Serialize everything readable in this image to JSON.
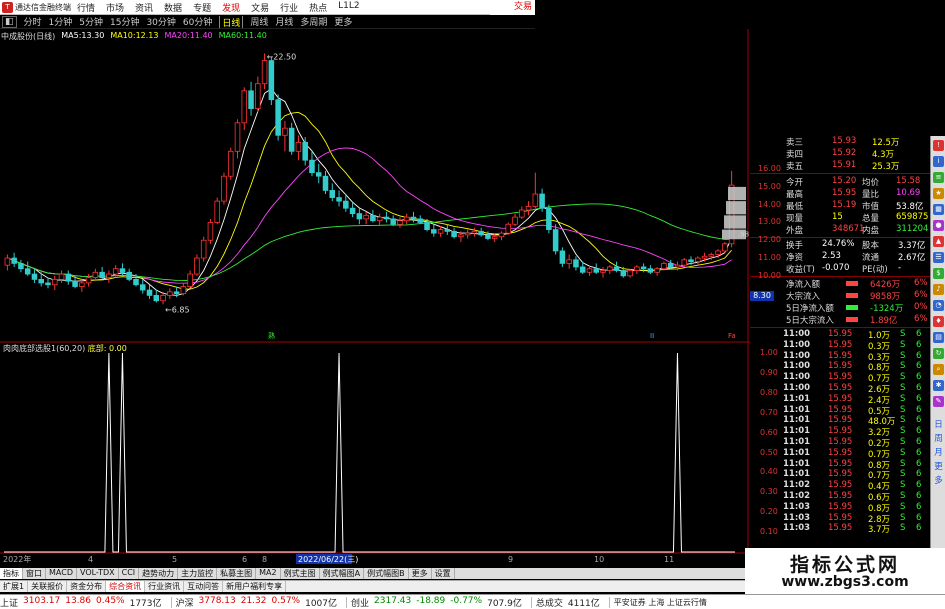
{
  "app": {
    "title": "通达信金融终端",
    "top_right": "交易"
  },
  "menu": [
    "行情",
    "市场",
    "资讯",
    "数据",
    "专题",
    "发现",
    "文易",
    "行业",
    "热点",
    "L1L2"
  ],
  "periods": [
    {
      "label": "分时",
      "active": false
    },
    {
      "label": "1分钟",
      "active": false
    },
    {
      "label": "5分钟",
      "active": false
    },
    {
      "label": "15分钟",
      "active": false
    },
    {
      "label": "30分钟",
      "active": false
    },
    {
      "label": "60分钟",
      "active": false
    },
    {
      "label": "日线",
      "active": true
    },
    {
      "label": "周线",
      "active": false
    },
    {
      "label": "月线",
      "active": false
    },
    {
      "label": "多周期",
      "active": false
    },
    {
      "label": "更多",
      "active": false
    }
  ],
  "legend": {
    "stock": "中成股份(日线)",
    "ma": [
      {
        "name": "MA5:",
        "value": "13.30",
        "color": "#ffffff"
      },
      {
        "name": "MA10:",
        "value": "12.13",
        "color": "#ffff00"
      },
      {
        "name": "MA20:",
        "value": "11.40",
        "color": "#ff44ff"
      },
      {
        "name": "MA60:",
        "value": "11.40",
        "color": "#33ee33"
      }
    ]
  },
  "price_annotations": {
    "high": "22.50",
    "low": "6.85",
    "right": ".98"
  },
  "event_marks": [
    {
      "label": "熟",
      "color": "#33ee33"
    },
    {
      "label": "II",
      "color": "#44aaff"
    },
    {
      "label": "Fa",
      "color": "#ff4444"
    }
  ],
  "indicator": {
    "title": "肉肉底部选股1(60,20)",
    "sub": "底部: 0.00"
  },
  "price_ticks": [
    "16.00",
    "15.00",
    "14.00",
    "13.00",
    "12.00",
    "11.00",
    "10.00"
  ],
  "price_tag": "8.30",
  "ind_ticks": [
    "1.00",
    "0.90",
    "0.80",
    "0.70",
    "0.60",
    "0.50",
    "0.40",
    "0.30",
    "0.20",
    "0.10"
  ],
  "xaxis": {
    "labels": [
      "2022年",
      "4",
      "5",
      "6",
      "8",
      "2022/06/22(三)",
      "9",
      "10",
      "11"
    ]
  },
  "chart_data": {
    "type": "candlestick",
    "candles_ohlc": [
      [
        10.6,
        11.2,
        10.3,
        11.0
      ],
      [
        11.0,
        11.3,
        10.5,
        10.7
      ],
      [
        10.7,
        10.9,
        10.2,
        10.4
      ],
      [
        10.4,
        10.8,
        10.0,
        10.1
      ],
      [
        10.1,
        10.4,
        9.6,
        9.8
      ],
      [
        9.8,
        10.2,
        9.4,
        9.6
      ],
      [
        9.6,
        9.9,
        9.3,
        9.5
      ],
      [
        9.5,
        10.0,
        9.2,
        9.8
      ],
      [
        9.8,
        10.3,
        9.6,
        10.1
      ],
      [
        10.1,
        10.3,
        9.5,
        9.7
      ],
      [
        9.7,
        10.0,
        9.3,
        9.4
      ],
      [
        9.4,
        9.8,
        9.1,
        9.6
      ],
      [
        9.6,
        10.1,
        9.4,
        9.9
      ],
      [
        9.9,
        10.4,
        9.7,
        10.2
      ],
      [
        10.2,
        10.5,
        9.8,
        9.9
      ],
      [
        9.9,
        10.3,
        9.6,
        10.1
      ],
      [
        10.1,
        10.6,
        9.9,
        10.4
      ],
      [
        10.4,
        10.7,
        10.0,
        10.2
      ],
      [
        10.2,
        10.4,
        9.7,
        9.8
      ],
      [
        9.8,
        10.1,
        9.4,
        9.5
      ],
      [
        9.5,
        9.8,
        9.0,
        9.2
      ],
      [
        9.2,
        9.5,
        8.7,
        8.9
      ],
      [
        8.9,
        9.2,
        8.5,
        8.6
      ],
      [
        8.6,
        9.1,
        8.4,
        8.9
      ],
      [
        8.9,
        9.3,
        8.7,
        9.1
      ],
      [
        9.1,
        9.4,
        8.8,
        9.0
      ],
      [
        9.0,
        9.6,
        8.9,
        9.4
      ],
      [
        9.4,
        10.3,
        9.3,
        10.1
      ],
      [
        10.1,
        11.2,
        10.0,
        11.0
      ],
      [
        11.0,
        12.2,
        10.8,
        12.0
      ],
      [
        12.0,
        13.2,
        11.8,
        13.0
      ],
      [
        13.0,
        14.4,
        12.9,
        14.2
      ],
      [
        14.2,
        15.8,
        14.0,
        15.6
      ],
      [
        15.6,
        17.2,
        15.4,
        17.0
      ],
      [
        17.0,
        18.8,
        16.6,
        18.6
      ],
      [
        18.6,
        20.6,
        18.2,
        20.4
      ],
      [
        20.4,
        20.9,
        19.0,
        19.4
      ],
      [
        19.4,
        21.2,
        19.2,
        20.8
      ],
      [
        20.8,
        22.5,
        20.5,
        22.1
      ],
      [
        22.1,
        22.3,
        19.6,
        19.9
      ],
      [
        19.9,
        20.2,
        17.6,
        17.9
      ],
      [
        17.9,
        18.7,
        17.0,
        18.3
      ],
      [
        18.3,
        18.6,
        16.8,
        17.0
      ],
      [
        17.0,
        17.9,
        16.5,
        17.5
      ],
      [
        17.5,
        17.8,
        16.2,
        16.5
      ],
      [
        16.5,
        17.0,
        15.6,
        15.8
      ],
      [
        15.8,
        16.3,
        15.2,
        15.6
      ],
      [
        15.6,
        15.9,
        14.6,
        14.8
      ],
      [
        14.8,
        15.2,
        14.2,
        14.4
      ],
      [
        14.4,
        14.8,
        13.9,
        14.2
      ],
      [
        14.2,
        14.6,
        13.6,
        13.8
      ],
      [
        13.8,
        14.1,
        13.3,
        13.5
      ],
      [
        13.5,
        13.8,
        12.9,
        13.2
      ],
      [
        13.2,
        13.6,
        12.9,
        13.4
      ],
      [
        13.4,
        13.7,
        13.0,
        13.1
      ],
      [
        13.1,
        13.5,
        12.8,
        13.3
      ],
      [
        13.3,
        13.6,
        13.0,
        13.2
      ],
      [
        13.2,
        13.4,
        12.8,
        12.9
      ],
      [
        12.9,
        13.3,
        12.7,
        13.1
      ],
      [
        13.1,
        13.5,
        12.9,
        13.3
      ],
      [
        13.3,
        13.6,
        13.0,
        13.2
      ],
      [
        13.2,
        13.4,
        12.9,
        13.0
      ],
      [
        13.0,
        13.2,
        12.5,
        12.6
      ],
      [
        12.6,
        12.9,
        12.2,
        12.4
      ],
      [
        12.4,
        12.8,
        12.2,
        12.6
      ],
      [
        12.6,
        12.9,
        12.3,
        12.5
      ],
      [
        12.5,
        12.7,
        12.1,
        12.2
      ],
      [
        12.2,
        12.5,
        11.9,
        12.3
      ],
      [
        12.3,
        12.6,
        12.1,
        12.4
      ],
      [
        12.4,
        12.7,
        12.2,
        12.5
      ],
      [
        12.5,
        12.7,
        12.2,
        12.3
      ],
      [
        12.3,
        12.5,
        12.0,
        12.1
      ],
      [
        12.1,
        12.4,
        11.9,
        12.2
      ],
      [
        12.2,
        12.5,
        12.0,
        12.4
      ],
      [
        12.4,
        13.0,
        12.3,
        12.9
      ],
      [
        12.9,
        13.5,
        12.8,
        13.3
      ],
      [
        13.3,
        13.9,
        13.2,
        13.7
      ],
      [
        13.7,
        14.2,
        13.4,
        13.9
      ],
      [
        13.9,
        15.8,
        13.8,
        14.6
      ],
      [
        14.6,
        14.9,
        13.6,
        13.8
      ],
      [
        13.8,
        14.0,
        12.4,
        12.6
      ],
      [
        12.6,
        12.9,
        11.2,
        11.4
      ],
      [
        11.4,
        11.6,
        10.5,
        10.7
      ],
      [
        10.7,
        11.2,
        10.4,
        10.9
      ],
      [
        10.9,
        11.1,
        10.3,
        10.5
      ],
      [
        10.5,
        10.8,
        10.1,
        10.2
      ],
      [
        10.2,
        10.6,
        10.0,
        10.4
      ],
      [
        10.4,
        10.7,
        10.1,
        10.2
      ],
      [
        10.2,
        10.5,
        9.9,
        10.3
      ],
      [
        10.3,
        10.6,
        10.1,
        10.5
      ],
      [
        10.5,
        10.8,
        10.2,
        10.3
      ],
      [
        10.3,
        10.5,
        9.9,
        10.0
      ],
      [
        10.0,
        10.4,
        9.9,
        10.3
      ],
      [
        10.3,
        10.6,
        10.1,
        10.5
      ],
      [
        10.5,
        10.7,
        10.2,
        10.4
      ],
      [
        10.4,
        10.6,
        10.1,
        10.2
      ],
      [
        10.2,
        10.5,
        10.0,
        10.4
      ],
      [
        10.4,
        10.8,
        10.3,
        10.7
      ],
      [
        10.7,
        10.9,
        10.4,
        10.5
      ],
      [
        10.5,
        10.8,
        10.3,
        10.6
      ],
      [
        10.6,
        11.0,
        10.5,
        10.9
      ],
      [
        10.9,
        11.1,
        10.6,
        10.8
      ],
      [
        10.8,
        11.1,
        10.6,
        11.0
      ],
      [
        11.0,
        11.3,
        10.8,
        11.1
      ],
      [
        11.1,
        11.3,
        10.9,
        11.2
      ],
      [
        11.2,
        11.5,
        11.0,
        11.4
      ],
      [
        11.4,
        11.9,
        11.3,
        11.8
      ],
      [
        11.8,
        15.9,
        11.6,
        15.1
      ]
    ],
    "ylim": [
      6.0,
      23.2
    ],
    "indicator_spikes": [
      15,
      17,
      49,
      99
    ],
    "indicator_ylim": [
      0,
      1.0
    ]
  },
  "quote": {
    "rows": [
      {
        "l": "卖三",
        "v": "15.93",
        "r": "12.5万"
      },
      {
        "l": "卖四",
        "v": "15.92",
        "r": "4.3万"
      },
      {
        "l": "卖五",
        "v": "15.91",
        "r": "25.3万"
      }
    ],
    "stats": [
      {
        "l1": "今开",
        "v1": "15.20",
        "l2": "均价",
        "v2": "15.58",
        "c1": "#ff4444",
        "c2": "#ff4444"
      },
      {
        "l1": "最高",
        "v1": "15.95",
        "l2": "量比",
        "v2": "10.69",
        "c1": "#ff4444",
        "c2": "#ff44ff"
      },
      {
        "l1": "最低",
        "v1": "15.19",
        "l2": "市值",
        "v2": "53.8亿",
        "c1": "#ff4444",
        "c2": "#ffffff"
      },
      {
        "l1": "现量",
        "v1": "15",
        "l2": "总量",
        "v2": "659875",
        "c1": "#ffff00",
        "c2": "#ffff00"
      },
      {
        "l1": "外盘",
        "v1": "348671",
        "l2": "内盘",
        "v2": "311204",
        "c1": "#ff4444",
        "c2": "#33ee33"
      }
    ],
    "stats2": [
      {
        "l1": "换手",
        "v1": "24.76%",
        "l2": "股本",
        "v2": "3.37亿"
      },
      {
        "l1": "净资",
        "v1": "2.53",
        "l2": "流通",
        "v2": "2.67亿"
      },
      {
        "l1": "收益(T)",
        "v1": "-0.070",
        "l2": "PE(动)",
        "v2": "-"
      }
    ],
    "flows": [
      {
        "l": "净流入额",
        "v": "6426万",
        "p": "6%",
        "c": "#ff4444"
      },
      {
        "l": "大宗流入",
        "v": "9858万",
        "p": "6%",
        "c": "#ff4444"
      },
      {
        "l": "5日净流入额",
        "v": "-1324万",
        "p": "0%",
        "c": "#33ee33"
      },
      {
        "l": "5日大宗流入",
        "v": "1.89亿",
        "p": "6%",
        "c": "#ff4444"
      }
    ],
    "ticks": [
      {
        "t": "11:00",
        "p": "15.95",
        "q": "1.0万",
        "s": "S",
        "n": "6"
      },
      {
        "t": "11:00",
        "p": "15.95",
        "q": "0.3万",
        "s": "S",
        "n": "6"
      },
      {
        "t": "11:00",
        "p": "15.95",
        "q": "0.3万",
        "s": "S",
        "n": "6"
      },
      {
        "t": "11:00",
        "p": "15.95",
        "q": "0.8万",
        "s": "S",
        "n": "6"
      },
      {
        "t": "11:00",
        "p": "15.95",
        "q": "0.7万",
        "s": "S",
        "n": "6"
      },
      {
        "t": "11:00",
        "p": "15.95",
        "q": "2.6万",
        "s": "S",
        "n": "6"
      },
      {
        "t": "11:01",
        "p": "15.95",
        "q": "2.4万",
        "s": "S",
        "n": "6"
      },
      {
        "t": "11:01",
        "p": "15.95",
        "q": "0.5万",
        "s": "S",
        "n": "6"
      },
      {
        "t": "11:01",
        "p": "15.95",
        "q": "48.0万",
        "s": "S",
        "n": "6"
      },
      {
        "t": "11:01",
        "p": "15.95",
        "q": "3.2万",
        "s": "S",
        "n": "6"
      },
      {
        "t": "11:01",
        "p": "15.95",
        "q": "0.2万",
        "s": "S",
        "n": "6"
      },
      {
        "t": "11:01",
        "p": "15.95",
        "q": "0.7万",
        "s": "S",
        "n": "6"
      },
      {
        "t": "11:01",
        "p": "15.95",
        "q": "0.8万",
        "s": "S",
        "n": "6"
      },
      {
        "t": "11:01",
        "p": "15.95",
        "q": "0.7万",
        "s": "S",
        "n": "6"
      },
      {
        "t": "11:02",
        "p": "15.95",
        "q": "0.4万",
        "s": "S",
        "n": "6"
      },
      {
        "t": "11:02",
        "p": "15.95",
        "q": "0.6万",
        "s": "S",
        "n": "6"
      },
      {
        "t": "11:03",
        "p": "15.95",
        "q": "0.8万",
        "s": "S",
        "n": "6"
      },
      {
        "t": "11:03",
        "p": "15.95",
        "q": "2.8万",
        "s": "S",
        "n": "6"
      },
      {
        "t": "11:03",
        "p": "15.95",
        "q": "3.7万",
        "s": "S",
        "n": "6"
      }
    ]
  },
  "sidebar": {
    "labels": [
      "日",
      "周",
      "月",
      "更",
      "多"
    ]
  },
  "tabs": [
    "指标",
    "窗口",
    "MACD",
    "VOL-TDX",
    "CCI",
    "趋势动力",
    "主力监控",
    "私募主图",
    "MA2",
    "例式主图",
    "例式幅图A",
    "例式幅图B",
    "更多",
    "设置"
  ],
  "tabs2": [
    "扩展1",
    "关联报价",
    "资金分布",
    "综合资讯",
    "行业资讯",
    "互动问答",
    "新用户福利专享"
  ],
  "tabs_right": "模板",
  "status": {
    "items": [
      {
        "name": "上证",
        "value": "3103.17",
        "chg": "13.86",
        "pct": "0.45%",
        "amt": "1773亿"
      },
      {
        "name": "沪深",
        "value": "3778.13",
        "chg": "21.32",
        "pct": "0.57%",
        "amt": "1007亿"
      },
      {
        "name": "创业",
        "value": "2317.43",
        "chg": "-18.89",
        "pct": "-0.77%",
        "amt": "707.9亿"
      }
    ],
    "total_label": "总成交",
    "total": "4111亿",
    "broker": "平安证券 上海 上证云行情"
  },
  "watermark": {
    "line1": "指标公式网",
    "line2": "www.zbgs3.com"
  }
}
